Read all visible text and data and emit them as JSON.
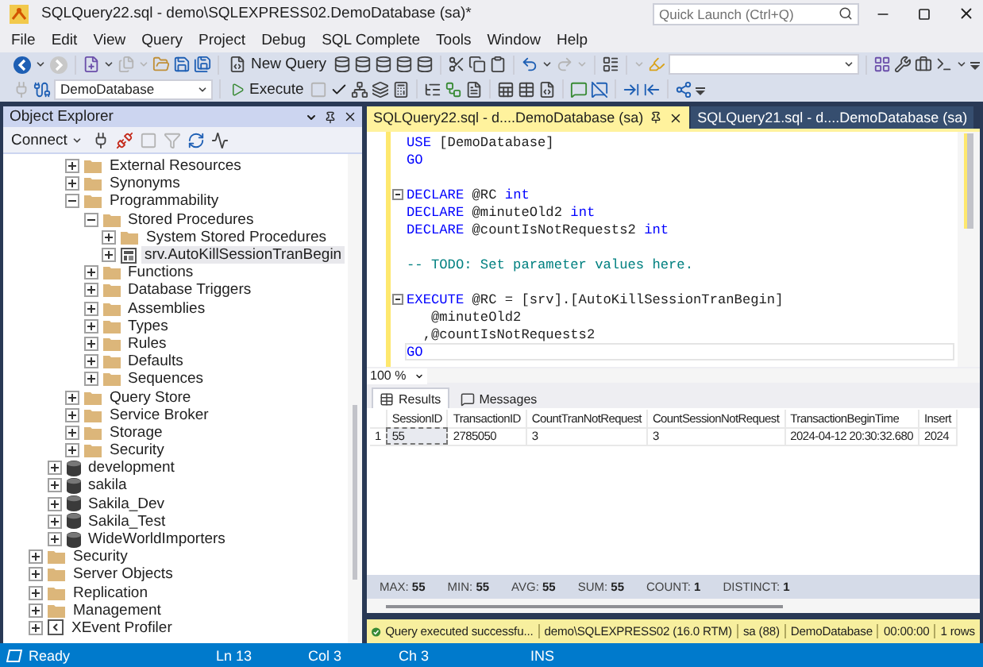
{
  "window": {
    "title": "SQLQuery22.sql - demo\\SQLEXPRESS02.DemoDatabase (sa)*"
  },
  "quick_launch": {
    "placeholder": "Quick Launch (Ctrl+Q)"
  },
  "menu": [
    "File",
    "Edit",
    "View",
    "Query",
    "Project",
    "Debug",
    "SQL Complete",
    "Tools",
    "Window",
    "Help"
  ],
  "toolbars": [
    {
      "items": [
        {
          "kind": "back",
          "disabled": false
        },
        {
          "kind": "dropdown",
          "disabled": false
        },
        {
          "kind": "forward",
          "disabled": true
        },
        {
          "kind": "separator"
        },
        {
          "kind": "new-project",
          "disabled": false
        },
        {
          "kind": "dropdown",
          "disabled": false
        },
        {
          "kind": "add-item",
          "disabled": true
        },
        {
          "kind": "dropdown",
          "disabled": true
        },
        {
          "kind": "open",
          "disabled": false
        },
        {
          "kind": "save",
          "disabled": false
        },
        {
          "kind": "save-all",
          "disabled": false
        },
        {
          "kind": "separator"
        },
        {
          "kind": "new-query",
          "label": "New Query",
          "disabled": false
        },
        {
          "kind": "db-query",
          "disabled": false
        },
        {
          "kind": "db-query",
          "disabled": false
        },
        {
          "kind": "db-query",
          "disabled": false
        },
        {
          "kind": "db-query",
          "disabled": false
        },
        {
          "kind": "db-query",
          "disabled": false
        },
        {
          "kind": "separator"
        },
        {
          "kind": "cut",
          "disabled": false
        },
        {
          "kind": "copy",
          "disabled": false
        },
        {
          "kind": "paste",
          "disabled": false
        },
        {
          "kind": "separator"
        },
        {
          "kind": "undo",
          "disabled": false
        },
        {
          "kind": "dropdown",
          "disabled": false
        },
        {
          "kind": "redo",
          "disabled": true
        },
        {
          "kind": "dropdown",
          "disabled": true
        },
        {
          "kind": "separator"
        },
        {
          "kind": "report",
          "disabled": false
        },
        {
          "kind": "separator"
        },
        {
          "kind": "dropdown",
          "disabled": true
        },
        {
          "kind": "find",
          "disabled": false
        },
        {
          "kind": "combo",
          "disabled": false
        },
        {
          "kind": "separator"
        },
        {
          "kind": "solution",
          "disabled": false
        },
        {
          "kind": "wrench",
          "disabled": false
        },
        {
          "kind": "toolbox",
          "disabled": false
        },
        {
          "kind": "console",
          "disabled": false
        },
        {
          "kind": "dropdown",
          "disabled": false
        },
        {
          "kind": "overflow",
          "disabled": false
        }
      ]
    },
    {
      "items": [
        {
          "kind": "plug",
          "disabled": true
        },
        {
          "kind": "plug-change",
          "disabled": false
        },
        {
          "kind": "combo",
          "value": "DemoDatabase",
          "disabled": false
        },
        {
          "kind": "separator"
        },
        {
          "kind": "execute",
          "label": "Execute",
          "disabled": false
        },
        {
          "kind": "stop",
          "disabled": true
        },
        {
          "kind": "check",
          "disabled": false
        },
        {
          "kind": "plan",
          "disabled": false
        },
        {
          "kind": "layers",
          "disabled": false
        },
        {
          "kind": "calculator",
          "disabled": false
        },
        {
          "kind": "separator"
        },
        {
          "kind": "list-tree",
          "disabled": false
        },
        {
          "kind": "workflow",
          "disabled": false
        },
        {
          "kind": "file-text",
          "disabled": false
        },
        {
          "kind": "separator"
        },
        {
          "kind": "text-results",
          "disabled": false
        },
        {
          "kind": "table",
          "disabled": false
        },
        {
          "kind": "file-results",
          "disabled": false
        },
        {
          "kind": "separator"
        },
        {
          "kind": "comment",
          "disabled": false
        },
        {
          "kind": "uncomment",
          "disabled": false
        },
        {
          "kind": "separator"
        },
        {
          "kind": "indent",
          "disabled": false
        },
        {
          "kind": "outdent",
          "disabled": false
        },
        {
          "kind": "separator"
        },
        {
          "kind": "share",
          "disabled": false
        },
        {
          "kind": "overflow",
          "disabled": false
        }
      ]
    }
  ],
  "object_explorer": {
    "title": "Object Explorer",
    "toolbar": [
      {
        "kind": "connect",
        "label": "Connect",
        "disabled": false
      },
      {
        "kind": "plug",
        "disabled": false
      },
      {
        "kind": "plug-x",
        "disabled": false
      },
      {
        "kind": "stop",
        "disabled": true
      },
      {
        "kind": "filter",
        "disabled": true
      },
      {
        "kind": "refresh",
        "disabled": false
      },
      {
        "kind": "activity",
        "disabled": false
      }
    ],
    "tree": [
      {
        "children": [
          {
            "children": [
              {
                "label": "External Resources",
                "kind": "folder",
                "expanded": false,
                "selected": false
              },
              {
                "label": "Synonyms",
                "kind": "folder",
                "expanded": false,
                "selected": false
              },
              {
                "label": "Programmability",
                "kind": "folder",
                "expanded": true,
                "selected": false,
                "children": [
                  {
                    "label": "Stored Procedures",
                    "kind": "folder",
                    "expanded": true,
                    "selected": false,
                    "children": [
                      {
                        "label": "System Stored Procedures",
                        "kind": "folder",
                        "expanded": false,
                        "selected": false
                      },
                      {
                        "label": "srv.AutoKillSessionTranBegin",
                        "kind": "procedure",
                        "expanded": false,
                        "selected": true
                      }
                    ]
                  },
                  {
                    "label": "Functions",
                    "kind": "folder",
                    "expanded": false,
                    "selected": false
                  },
                  {
                    "label": "Database Triggers",
                    "kind": "folder",
                    "expanded": false,
                    "selected": false
                  },
                  {
                    "label": "Assemblies",
                    "kind": "folder",
                    "expanded": false,
                    "selected": false
                  },
                  {
                    "label": "Types",
                    "kind": "folder",
                    "expanded": false,
                    "selected": false
                  },
                  {
                    "label": "Rules",
                    "kind": "folder",
                    "expanded": false,
                    "selected": false
                  },
                  {
                    "label": "Defaults",
                    "kind": "folder",
                    "expanded": false,
                    "selected": false
                  },
                  {
                    "label": "Sequences",
                    "kind": "folder",
                    "expanded": false,
                    "selected": false
                  }
                ]
              },
              {
                "label": "Query Store",
                "kind": "folder",
                "expanded": false,
                "selected": false
              },
              {
                "label": "Service Broker",
                "kind": "folder",
                "expanded": false,
                "selected": false
              },
              {
                "label": "Storage",
                "kind": "folder",
                "expanded": false,
                "selected": false
              },
              {
                "label": "Security",
                "kind": "folder",
                "expanded": false,
                "selected": false
              }
            ]
          },
          {
            "label": "development",
            "kind": "database",
            "expanded": false,
            "selected": false
          },
          {
            "label": "sakila",
            "kind": "database",
            "expanded": false,
            "selected": false
          },
          {
            "label": "Sakila_Dev",
            "kind": "database",
            "expanded": false,
            "selected": false
          },
          {
            "label": "Sakila_Test",
            "kind": "database",
            "expanded": false,
            "selected": false
          },
          {
            "label": "WideWorldImporters",
            "kind": "database",
            "expanded": false,
            "selected": false
          }
        ]
      },
      {
        "label": "Security",
        "kind": "folder",
        "expanded": false,
        "selected": false
      },
      {
        "label": "Server Objects",
        "kind": "folder",
        "expanded": false,
        "selected": false
      },
      {
        "label": "Replication",
        "kind": "folder",
        "expanded": false,
        "selected": false
      },
      {
        "label": "Management",
        "kind": "folder",
        "expanded": false,
        "selected": false
      },
      {
        "label": "XEvent Profiler",
        "kind": "profiler",
        "expanded": false,
        "selected": false
      }
    ]
  },
  "editor": {
    "tabs": [
      {
        "label": "SQLQuery22.sql - d....DemoDatabase (sa)",
        "selected": true
      },
      {
        "label": "SQLQuery21.sql - d....DemoDatabase (sa)",
        "selected": false
      }
    ],
    "lines": [
      {
        "fold": false,
        "current": false,
        "tokens": [
          {
            "kind": "keyword",
            "text": "USE "
          },
          {
            "kind": "plain",
            "text": "[DemoDatabase]"
          }
        ]
      },
      {
        "fold": false,
        "current": false,
        "tokens": [
          {
            "kind": "keyword",
            "text": "GO"
          }
        ]
      },
      {
        "fold": false,
        "current": false
      },
      {
        "fold": true,
        "current": false,
        "tokens": [
          {
            "kind": "keyword",
            "text": "DECLARE "
          },
          {
            "kind": "plain",
            "text": "@RC "
          },
          {
            "kind": "keyword",
            "text": "int"
          }
        ]
      },
      {
        "fold": false,
        "current": false,
        "tokens": [
          {
            "kind": "keyword",
            "text": "DECLARE "
          },
          {
            "kind": "plain",
            "text": "@minuteOld2 "
          },
          {
            "kind": "keyword",
            "text": "int"
          }
        ]
      },
      {
        "fold": false,
        "current": false,
        "tokens": [
          {
            "kind": "keyword",
            "text": "DECLARE "
          },
          {
            "kind": "plain",
            "text": "@countIsNotRequests2 "
          },
          {
            "kind": "keyword",
            "text": "int"
          }
        ]
      },
      {
        "fold": false,
        "current": false
      },
      {
        "fold": false,
        "current": false,
        "tokens": [
          {
            "kind": "comment",
            "text": "-- TODO: Set parameter values here."
          }
        ]
      },
      {
        "fold": false,
        "current": false
      },
      {
        "fold": true,
        "current": false,
        "tokens": [
          {
            "kind": "keyword",
            "text": "EXECUTE "
          },
          {
            "kind": "plain",
            "text": "@RC = [srv].[AutoKillSessionTranBegin]"
          }
        ]
      },
      {
        "fold": false,
        "current": false,
        "tokens": [
          {
            "kind": "plain",
            "text": "   @minuteOld2"
          }
        ]
      },
      {
        "fold": false,
        "current": false,
        "tokens": [
          {
            "kind": "plain",
            "text": "  ,@countIsNotRequests2"
          }
        ]
      },
      {
        "fold": false,
        "current": true,
        "tokens": [
          {
            "kind": "keyword",
            "text": "GO"
          }
        ]
      }
    ],
    "zoom": "100 %"
  },
  "results": {
    "tabs": [
      {
        "label": "Results",
        "kind": "grid",
        "selected": true
      },
      {
        "label": "Messages",
        "kind": "messages",
        "selected": false
      }
    ],
    "columns": [
      "SessionID",
      "TransactionID",
      "CountTranNotRequest",
      "CountSessionNotRequest",
      "TransactionBeginTime",
      "Insert"
    ],
    "rows": [
      {
        "number": "1",
        "cells": [
          {
            "text": "55",
            "selected": true
          },
          {
            "text": "2785050",
            "selected": false
          },
          {
            "text": "3",
            "selected": false
          },
          {
            "text": "3",
            "selected": false
          },
          {
            "text": "2024-04-12 20:30:32.680",
            "selected": false
          },
          {
            "text": "2024",
            "selected": false
          }
        ]
      }
    ],
    "aggregates": [
      "MAX: **55**",
      "MIN: **55**",
      "AVG: **55**",
      "SUM: **55**",
      "COUNT: **1**",
      "DISTINCT: **1**"
    ]
  },
  "query_status": {
    "message": "Query executed successfu...",
    "server": "demo\\SQLEXPRESS02 (16.0 RTM)",
    "user": "sa (88)",
    "database": "DemoDatabase",
    "elapsed": "00:00:00",
    "rows": "1 rows"
  },
  "status_bar": {
    "message": "Ready",
    "line": "Ln 13",
    "column": "Col 3",
    "char": "Ch 3",
    "mode": "INS"
  }
}
